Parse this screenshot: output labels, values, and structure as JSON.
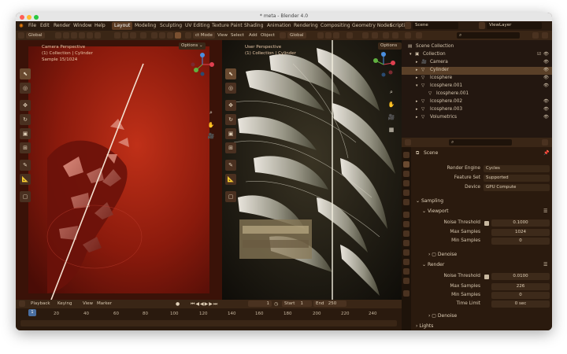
{
  "window": {
    "title": "* meta - Blender 4.0"
  },
  "menu": [
    "File",
    "Edit",
    "Render",
    "Window",
    "Help"
  ],
  "workspaces": [
    "Layout",
    "Modeling",
    "Sculpting",
    "UV Editing",
    "Texture Paint",
    "Shading",
    "Animation",
    "Rendering",
    "Compositing",
    "Geometry Nodes",
    "Scripti"
  ],
  "active_workspace": "Layout",
  "top_right": {
    "scene": "Scene",
    "viewlayer": "ViewLayer"
  },
  "viewport_header": {
    "orientation": "Global",
    "mode": "ct Mode",
    "menus": [
      "View",
      "Select",
      "Add",
      "Object"
    ],
    "orientation2": "Global"
  },
  "left_viewport": {
    "line1": "Camera Perspective",
    "line2": "(1) Collection | Cylinder",
    "line3": "Sample 15/1024",
    "options": "Options"
  },
  "right_viewport": {
    "line1": "User Perspective",
    "line2": "(1) Collection | Cylinder",
    "options": "Options"
  },
  "outliner": {
    "rows": [
      {
        "label": "Scene Collection",
        "indent": 0
      },
      {
        "label": "Collection",
        "indent": 1
      },
      {
        "label": "Camera",
        "indent": 2
      },
      {
        "label": "Cylinder",
        "indent": 2,
        "selected": true
      },
      {
        "label": "Icosphere",
        "indent": 2
      },
      {
        "label": "Icosphere.001",
        "indent": 2
      },
      {
        "label": "Icosphere.001",
        "indent": 3
      },
      {
        "label": "Icosphere.002",
        "indent": 2
      },
      {
        "label": "Icosphere.003",
        "indent": 2
      },
      {
        "label": "Volumetrics",
        "indent": 2
      }
    ]
  },
  "properties": {
    "context": "Scene",
    "render_engine_label": "Render Engine",
    "render_engine": "Cycles",
    "feature_set_label": "Feature Set",
    "feature_set": "Supported",
    "device_label": "Device",
    "device": "GPU Compute",
    "sampling": "Sampling",
    "viewport": "Viewport",
    "noise_threshold_label": "Noise Threshold",
    "vp_noise": "0.1000",
    "max_samples_label": "Max Samples",
    "vp_max": "1024",
    "min_samples_label": "Min Samples",
    "vp_min": "0",
    "denoise": "Denoise",
    "render": "Render",
    "r_noise": "0.0100",
    "r_max": "226",
    "r_min": "0",
    "time_limit_label": "Time Limit",
    "r_time": "0 sec",
    "denoise2": "Denoise",
    "lights": "Lights"
  },
  "timeline": {
    "playback": "Playback",
    "keying": "Keying",
    "view": "View",
    "marker": "Marker",
    "current": "1",
    "start_label": "Start",
    "start": "1",
    "end_label": "End",
    "end": "250",
    "ticks": [
      "20",
      "40",
      "60",
      "80",
      "100",
      "120",
      "140",
      "160",
      "180",
      "200",
      "220",
      "240"
    ],
    "playhead": "1"
  },
  "colors": {
    "accent": "#e87d0d",
    "selection": "#5a4028",
    "field": "#3d2a1a",
    "bg": "#2a1a0e"
  }
}
